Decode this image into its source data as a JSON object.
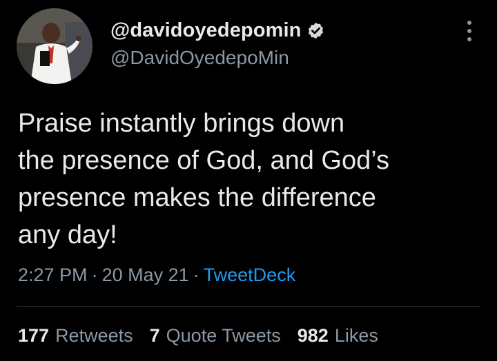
{
  "user": {
    "display_name": "@davidoyedepomin",
    "handle": "@DavidOyedepoMin",
    "verified": true,
    "verified_color": "#d9d9d9"
  },
  "tweet": {
    "text": "Praise instantly brings down\nthe presence of God, and God’s\npresence makes the difference\nany day!",
    "time": "2:27 PM",
    "separator": "·",
    "date": "20 May 21",
    "source": "TweetDeck"
  },
  "stats": [
    {
      "count": "177",
      "label": "Retweets"
    },
    {
      "count": "7",
      "label": "Quote Tweets"
    },
    {
      "count": "982",
      "label": "Likes"
    }
  ],
  "colors": {
    "background": "#000000",
    "primary_text": "#e7e9ea",
    "secondary_text": "#8b98a5",
    "link": "#1d9bf0",
    "divider": "#2f3336"
  },
  "icons": {
    "more": "more-vertical-icon",
    "verified": "verified-badge-icon"
  }
}
